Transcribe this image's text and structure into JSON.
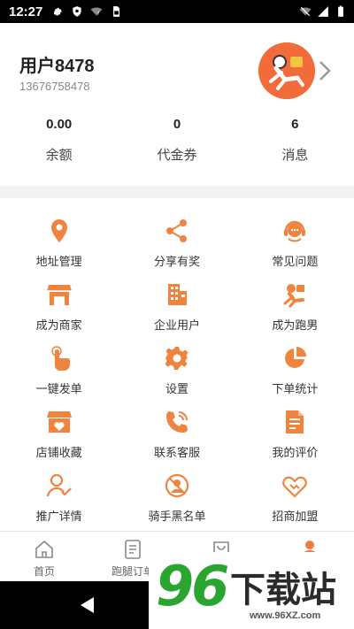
{
  "status_bar": {
    "time": "12:27",
    "left_icons": [
      "gear-icon",
      "shield-icon",
      "wifi-question-icon",
      "sim-card-icon"
    ],
    "right_icons": [
      "wifi-off-icon",
      "signal-icon",
      "battery-icon"
    ]
  },
  "profile": {
    "username": "用户8478",
    "phone": "13676758478",
    "avatar_color": "#f26b3a"
  },
  "stats": [
    {
      "value": "0.00",
      "label": "余额"
    },
    {
      "value": "0",
      "label": "代金券"
    },
    {
      "value": "6",
      "label": "消息"
    }
  ],
  "menu": [
    {
      "label": "地址管理",
      "icon": "location-pin-icon"
    },
    {
      "label": "分享有奖",
      "icon": "share-icon"
    },
    {
      "label": "常见问题",
      "icon": "headset-icon"
    },
    {
      "label": "成为商家",
      "icon": "storefront-icon"
    },
    {
      "label": "企业用户",
      "icon": "building-icon"
    },
    {
      "label": "成为跑男",
      "icon": "runner-icon"
    },
    {
      "label": "一键发单",
      "icon": "tap-finger-icon"
    },
    {
      "label": "设置",
      "icon": "gear-icon"
    },
    {
      "label": "下单统计",
      "icon": "pie-chart-icon"
    },
    {
      "label": "店铺收藏",
      "icon": "shop-heart-icon"
    },
    {
      "label": "联系客服",
      "icon": "phone-call-icon"
    },
    {
      "label": "我的评价",
      "icon": "review-doc-icon"
    },
    {
      "label": "推广详情",
      "icon": "user-check-icon"
    },
    {
      "label": "骑手黑名单",
      "icon": "user-block-icon"
    },
    {
      "label": "招商加盟",
      "icon": "handshake-icon"
    }
  ],
  "bottom_nav": [
    {
      "label": "首页",
      "icon": "home-icon",
      "active": false
    },
    {
      "label": "跑腿订单",
      "icon": "order-doc-icon",
      "active": false
    },
    {
      "label": "",
      "icon": "shopping-bag-icon",
      "active": false
    },
    {
      "label": "",
      "icon": "person-icon",
      "active": true
    }
  ],
  "colors": {
    "accent": "#f07b3f",
    "icon": "#f0843f",
    "watermark_green": "#2aa530",
    "watermark_orange": "#f7a21a"
  },
  "watermark": {
    "number": "96",
    "text": "下载站",
    "url": "www.96XZ.com"
  }
}
